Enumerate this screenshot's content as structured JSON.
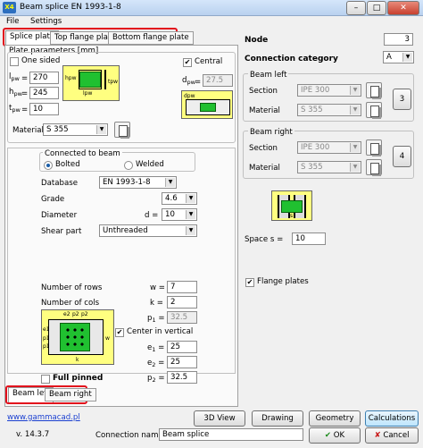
{
  "window": {
    "title": "Beam splice EN 1993-1-8",
    "app_badge": "X4",
    "minimize": "–",
    "maximize": "□",
    "close": "✕"
  },
  "menu": [
    "File",
    "Settings"
  ],
  "tabs_top": [
    "Splice plate",
    "Top flange plate",
    "Bottom flange plate"
  ],
  "plate": {
    "group_label": "Plate parameters [mm]",
    "one_sided_label": "One sided",
    "one_sided_checked": false,
    "central_label": "Central",
    "central_checked": true,
    "lpw_label": "l",
    "lpw_sub": "pw",
    "lpw_value": "270",
    "hpw_label": "h",
    "hpw_sub": "pw",
    "hpw_value": "245",
    "tpw_label": "t",
    "tpw_sub": "pw",
    "tpw_value": "10",
    "dpw_label": "d",
    "dpw_sub": "pw",
    "dpw_value": "27.5",
    "material_label": "Material",
    "material_value": "S 355",
    "fig_hpw": "hpw",
    "fig_lpw": "lpw",
    "fig_tpw": "tpw",
    "fig_dpw": "dpw"
  },
  "connected": {
    "group_label": "Connected to beam",
    "bolted_label": "Bolted",
    "welded_label": "Welded",
    "selected": "Bolted",
    "database_label": "Database",
    "database_value": "EN 1993-1-8",
    "grade_label": "Grade",
    "grade_value": "4.6",
    "diameter_label": "Diameter",
    "d_label": "d =",
    "diameter_value": "10",
    "shear_label": "Shear part",
    "shear_value": "Unthreaded"
  },
  "bolts": {
    "rows_label": "Number of rows",
    "w_label": "w =",
    "rows_value": "7",
    "cols_label": "Number of cols",
    "k_label": "k =",
    "cols_value": "2",
    "p1_label": "p",
    "p1_sub": "1",
    "p1_value": "32.5",
    "center_label": "Center in vertical",
    "center_checked": true,
    "e1_label": "e",
    "e1_sub": "1",
    "e1_value": "25",
    "e2_label": "e",
    "e2_sub": "2",
    "e2_value": "25",
    "p2_label": "p",
    "p2_sub": "2",
    "p2_value": "32.5",
    "full_pinned_label": "Full pinned",
    "full_pinned_checked": false,
    "fig_labels": [
      "e2",
      "p2",
      "p2",
      "e1",
      "p1",
      "p1",
      "w",
      "k"
    ]
  },
  "tabs_bottom": [
    "Beam left",
    "Beam right"
  ],
  "right": {
    "node_label": "Node",
    "node_value": "3",
    "category_label": "Connection category",
    "category_value": "A",
    "beam_left_label": "Beam left",
    "section_label": "Section",
    "material_label": "Material",
    "left_section": "IPE 300",
    "left_material": "S 355",
    "left_button": "3",
    "beam_right_label": "Beam right",
    "right_section": "IPE 300",
    "right_material": "S 355",
    "right_button": "4",
    "space_label": "Space s =",
    "space_value": "10",
    "fig_s": "s",
    "flange_plates_label": "Flange plates",
    "flange_plates_checked": true
  },
  "footer": {
    "website": "www.gammacad.pl",
    "version": "v. 14.3.7",
    "btn_3dview": "3D View",
    "btn_drawing": "Drawing",
    "btn_geometry": "Geometry",
    "btn_calculations": "Calculations",
    "connection_name_label": "Connection name",
    "connection_name_value": "Beam splice",
    "ok_label": "OK",
    "cancel_label": "Cancel",
    "ok_icon": "✔",
    "cancel_icon": "✘"
  },
  "colors": {
    "accent_red": "#e2101c",
    "figure_yellow": "#ffff80",
    "plate_green": "#20c030",
    "link_blue": "#1a3fd0"
  }
}
